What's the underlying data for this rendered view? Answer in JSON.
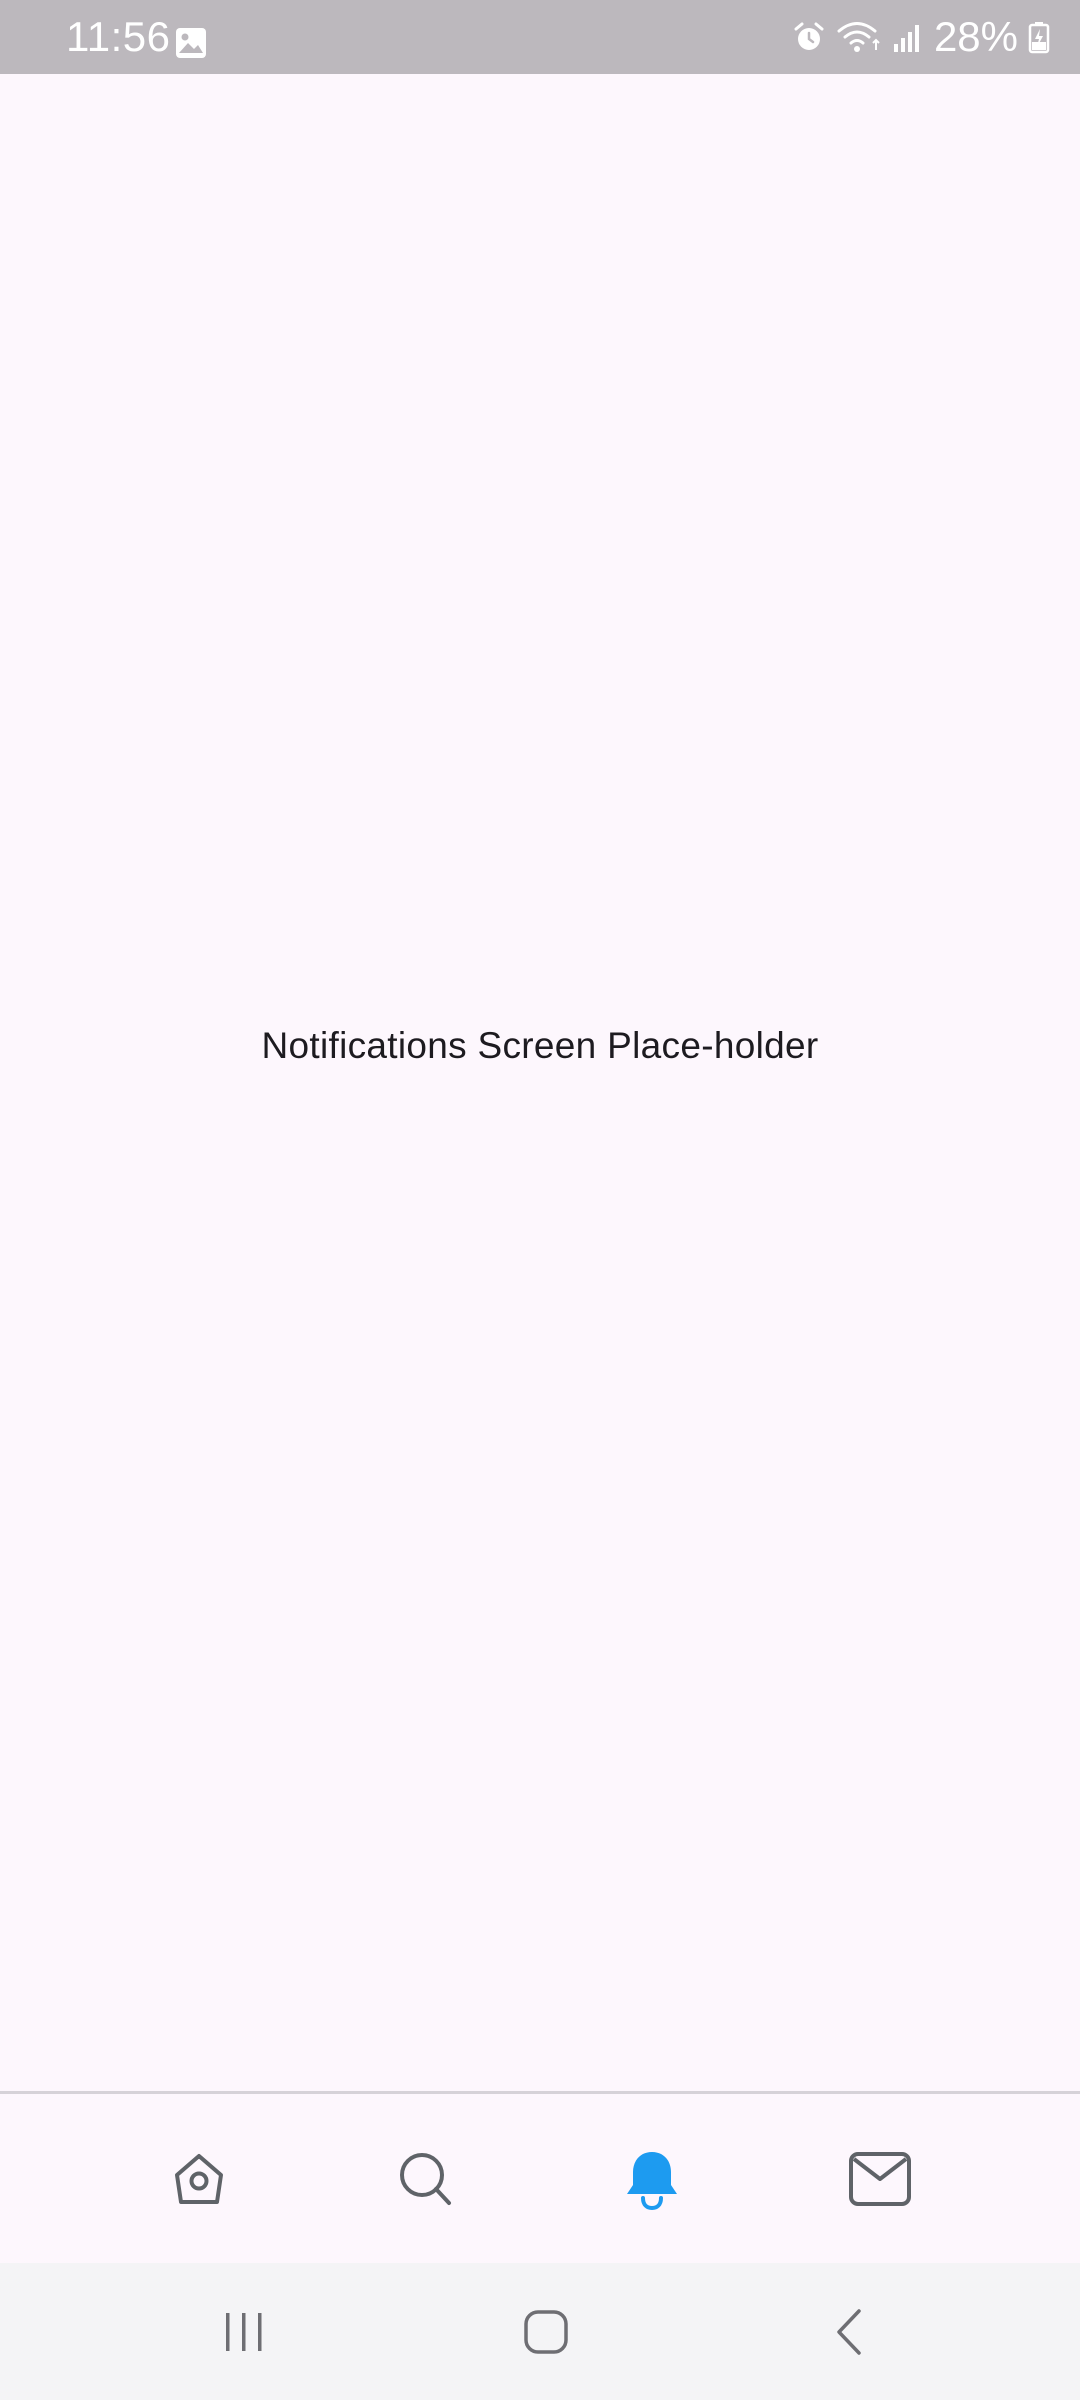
{
  "status_bar": {
    "time": "11:56",
    "battery": "28%",
    "icons": [
      "gallery-icon",
      "alarm-icon",
      "wifi-icon",
      "signal-icon",
      "battery-icon"
    ]
  },
  "main": {
    "placeholder": "Notifications Screen Place-holder"
  },
  "bottom_nav": {
    "items": [
      {
        "icon": "home-icon",
        "active": false
      },
      {
        "icon": "search-icon",
        "active": false
      },
      {
        "icon": "bell-icon",
        "active": true
      },
      {
        "icon": "mail-icon",
        "active": false
      }
    ],
    "active_color": "#1d9bf0",
    "inactive_color": "#5f6368"
  },
  "system_nav": {
    "buttons": [
      "recents-icon",
      "home-circle-icon",
      "back-icon"
    ]
  }
}
